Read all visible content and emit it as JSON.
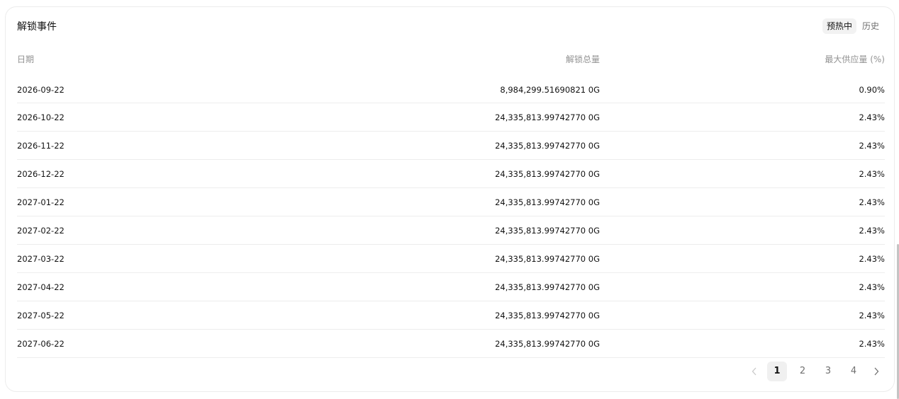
{
  "card": {
    "title": "解锁事件",
    "tabs": [
      {
        "label": "预热中",
        "active": true
      },
      {
        "label": "历史",
        "active": false
      }
    ]
  },
  "table": {
    "headers": {
      "date": "日期",
      "amount": "解锁总量",
      "pct": "最大供应量 (%)"
    },
    "rows": [
      {
        "date": "2026-09-22",
        "amount": "8,984,299.51690821 0G",
        "pct": "0.90%"
      },
      {
        "date": "2026-10-22",
        "amount": "24,335,813.99742770 0G",
        "pct": "2.43%"
      },
      {
        "date": "2026-11-22",
        "amount": "24,335,813.99742770 0G",
        "pct": "2.43%"
      },
      {
        "date": "2026-12-22",
        "amount": "24,335,813.99742770 0G",
        "pct": "2.43%"
      },
      {
        "date": "2027-01-22",
        "amount": "24,335,813.99742770 0G",
        "pct": "2.43%"
      },
      {
        "date": "2027-02-22",
        "amount": "24,335,813.99742770 0G",
        "pct": "2.43%"
      },
      {
        "date": "2027-03-22",
        "amount": "24,335,813.99742770 0G",
        "pct": "2.43%"
      },
      {
        "date": "2027-04-22",
        "amount": "24,335,813.99742770 0G",
        "pct": "2.43%"
      },
      {
        "date": "2027-05-22",
        "amount": "24,335,813.99742770 0G",
        "pct": "2.43%"
      },
      {
        "date": "2027-06-22",
        "amount": "24,335,813.99742770 0G",
        "pct": "2.43%"
      }
    ]
  },
  "pagination": {
    "pages": [
      "1",
      "2",
      "3",
      "4"
    ],
    "current": "1",
    "prev_icon": "chevron-left-icon",
    "next_icon": "chevron-right-icon"
  }
}
